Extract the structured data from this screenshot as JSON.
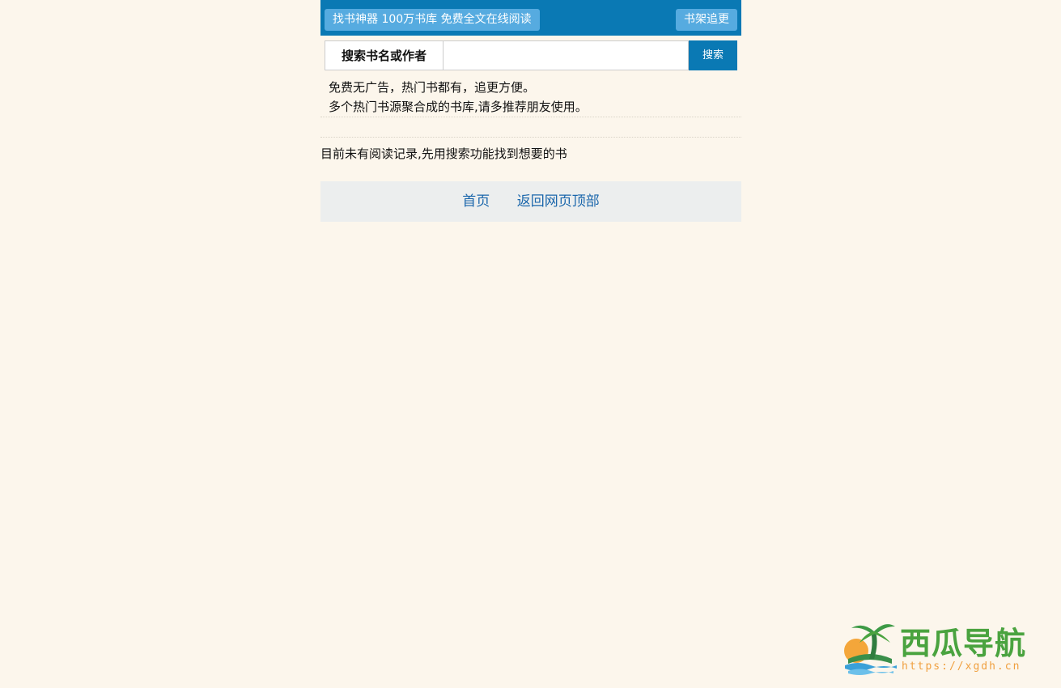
{
  "topbar": {
    "left_button": "找书神器 100万书库 免费全文在线阅读",
    "right_button": "书架追更"
  },
  "search": {
    "label": "搜索书名或作者",
    "value": "",
    "placeholder": "",
    "button": "搜索"
  },
  "intro": {
    "line1": "免费无广告，热门书都有，追更方便。",
    "line2": "多个热门书源聚合成的书库,请多推荐朋友使用。"
  },
  "history": {
    "empty_message": "目前未有阅读记录,先用搜索功能找到想要的书"
  },
  "footer": {
    "links": [
      "首页",
      "返回网页顶部"
    ]
  },
  "watermark": {
    "name": "西瓜导航",
    "url": "https://xgdh.cn"
  },
  "colors": {
    "page_background": "#fcf6ec",
    "primary_blue": "#0a79b4",
    "light_blue_button": "#56abe0",
    "footer_background": "#eceeee",
    "link_blue": "#1a66ab"
  }
}
